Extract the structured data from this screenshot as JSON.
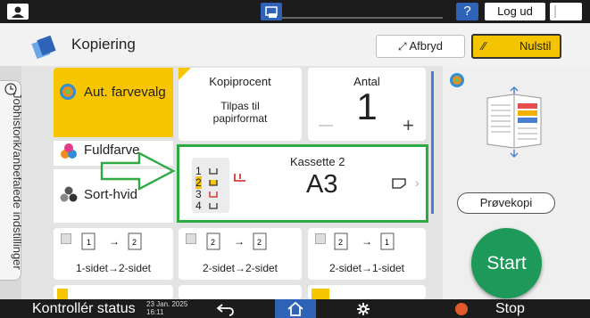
{
  "topbar": {
    "help_label": "?",
    "logout_label": "Log ud",
    "night_icon": "moon-icon",
    "user_icon": "user-icon"
  },
  "titlebar": {
    "title": "Kopiering",
    "stop_label": "Afbryd",
    "reset_label": "Nulstil"
  },
  "sidebar": {
    "tab_label": "Jobhistorik/anbefalede indstillinger"
  },
  "color_modes": [
    {
      "label": "Aut. farvevalg",
      "selected": true
    },
    {
      "label": "Fuldfarve",
      "selected": false
    },
    {
      "label": "Sort-hvid",
      "selected": false
    }
  ],
  "ratio": {
    "title": "Kopiprocent",
    "value_line1": "Tilpas til",
    "value_line2": "papirformat"
  },
  "quantity": {
    "title": "Antal",
    "value": "1",
    "minus": "—",
    "plus": "+"
  },
  "tray": {
    "title": "Kassette 2",
    "size": "A3",
    "trays": [
      "1",
      "2",
      "3",
      "4"
    ],
    "selected_tray": "2"
  },
  "duplex": [
    {
      "label": "1-sidet→2-sidet"
    },
    {
      "label": "2-sidet→2-sidet"
    },
    {
      "label": "2-sidet→1-sidet"
    }
  ],
  "right_panel": {
    "preview_label": "Prøvekopi",
    "start_label": "Start"
  },
  "bottombar": {
    "status_label": "Kontrollér status",
    "date_line1": "23 Jan. 2025",
    "date_line2": "16:11",
    "stop_label": "Stop"
  },
  "colors": {
    "accent_yellow": "#f7c600",
    "start_green": "#1d9a59",
    "highlight_green": "#2eaa44",
    "brand_blue": "#2f63b8"
  }
}
